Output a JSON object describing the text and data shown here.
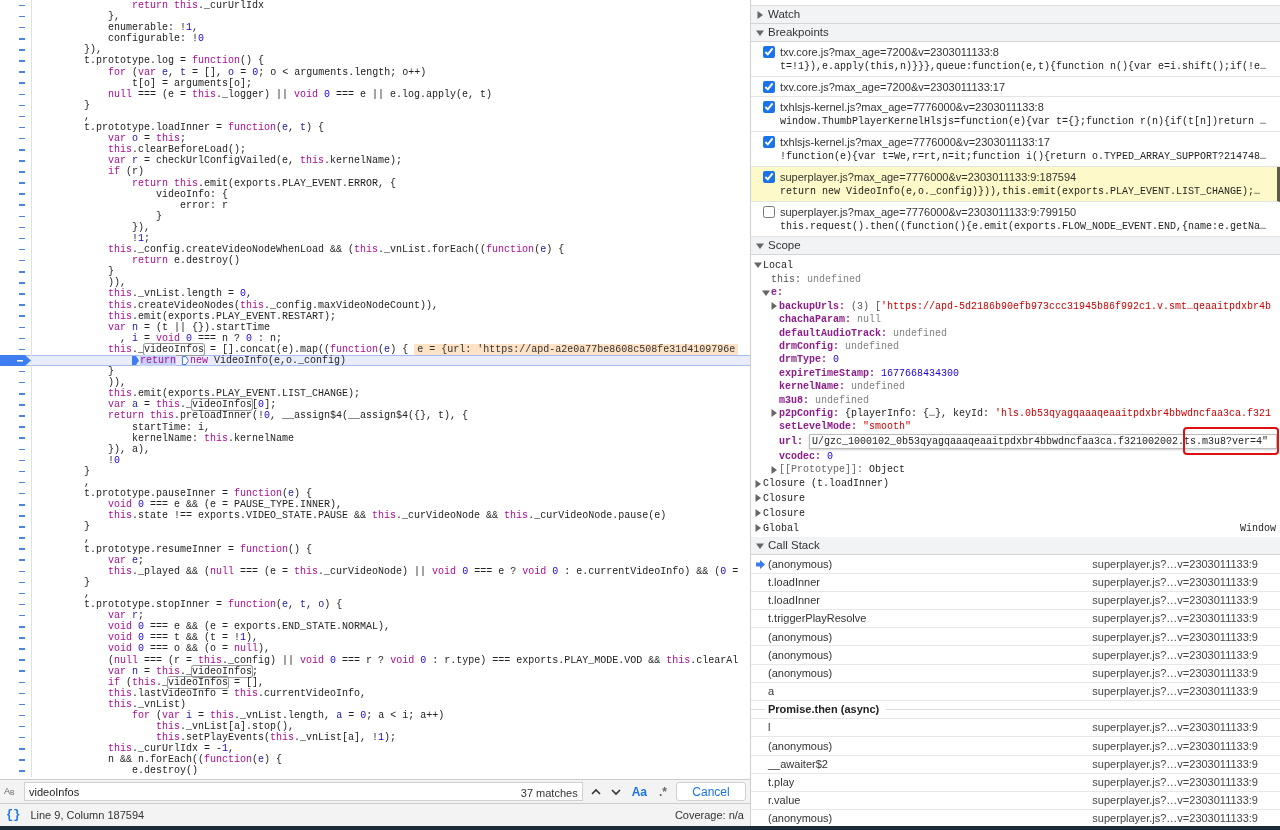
{
  "code": {
    "lines": [
      {
        "current": false,
        "tokens": [
          {
            "kind": "kw",
            "text": "                return this"
          },
          {
            "kind": "p",
            "text": "._curUrlIdx"
          }
        ]
      },
      {
        "current": false,
        "tokens": [
          {
            "kind": "p",
            "text": "            },"
          }
        ]
      },
      {
        "current": false,
        "tokens": [
          {
            "kind": "p",
            "text": "            enumerable: !"
          },
          {
            "kind": "num",
            "text": "1"
          },
          {
            "kind": "p",
            "text": ","
          }
        ]
      },
      {
        "current": false,
        "tokens": [
          {
            "kind": "p",
            "text": "            configurable: !"
          },
          {
            "kind": "num",
            "text": "0"
          }
        ]
      },
      {
        "current": false,
        "tokens": [
          {
            "kind": "p",
            "text": "        }),"
          }
        ]
      },
      {
        "current": false,
        "tokens": [
          {
            "kind": "p",
            "text": "        t.prototype.log = "
          },
          {
            "kind": "kw",
            "text": "function"
          },
          {
            "kind": "p",
            "text": "() {"
          }
        ]
      },
      {
        "current": false,
        "tokens": [
          {
            "kind": "kw",
            "text": "            for"
          },
          {
            "kind": "p",
            "text": " ("
          },
          {
            "kind": "kw",
            "text": "var "
          },
          {
            "kind": "def",
            "text": "e"
          },
          {
            "kind": "p",
            "text": ", "
          },
          {
            "kind": "def",
            "text": "t"
          },
          {
            "kind": "p",
            "text": " = [], "
          },
          {
            "kind": "def",
            "text": "o"
          },
          {
            "kind": "p",
            "text": " = "
          },
          {
            "kind": "num",
            "text": "0"
          },
          {
            "kind": "p",
            "text": "; o < arguments.length; o++)"
          }
        ]
      },
      {
        "current": false,
        "tokens": [
          {
            "kind": "p",
            "text": "                t[o] = arguments[o];"
          }
        ]
      },
      {
        "current": false,
        "tokens": [
          {
            "kind": "kw",
            "text": "            null"
          },
          {
            "kind": "p",
            "text": " === (e = "
          },
          {
            "kind": "kw",
            "text": "this"
          },
          {
            "kind": "p",
            "text": "._logger) || "
          },
          {
            "kind": "kw",
            "text": "void "
          },
          {
            "kind": "num",
            "text": "0"
          },
          {
            "kind": "p",
            "text": " === e || e.log.apply(e, t)"
          }
        ]
      },
      {
        "current": false,
        "tokens": [
          {
            "kind": "p",
            "text": "        }"
          }
        ]
      },
      {
        "current": false,
        "tokens": [
          {
            "kind": "p",
            "text": "        ,"
          }
        ]
      },
      {
        "current": false,
        "tokens": [
          {
            "kind": "p",
            "text": "        t.prototype.loadInner = "
          },
          {
            "kind": "kw",
            "text": "function"
          },
          {
            "kind": "p",
            "text": "("
          },
          {
            "kind": "def",
            "text": "e"
          },
          {
            "kind": "p",
            "text": ", "
          },
          {
            "kind": "def",
            "text": "t"
          },
          {
            "kind": "p",
            "text": ") {"
          }
        ]
      },
      {
        "current": false,
        "tokens": [
          {
            "kind": "kw",
            "text": "            var "
          },
          {
            "kind": "def",
            "text": "o"
          },
          {
            "kind": "p",
            "text": " = "
          },
          {
            "kind": "kw",
            "text": "this"
          },
          {
            "kind": "p",
            "text": ";"
          }
        ]
      },
      {
        "current": false,
        "tokens": [
          {
            "kind": "kw",
            "text": "            this"
          },
          {
            "kind": "p",
            "text": ".clearBeforeLoad();"
          }
        ]
      },
      {
        "current": false,
        "tokens": [
          {
            "kind": "kw",
            "text": "            var "
          },
          {
            "kind": "def",
            "text": "r"
          },
          {
            "kind": "p",
            "text": " = checkUrlConfigVailed(e, "
          },
          {
            "kind": "kw",
            "text": "this"
          },
          {
            "kind": "p",
            "text": ".kernelName);"
          }
        ]
      },
      {
        "current": false,
        "tokens": [
          {
            "kind": "kw",
            "text": "            if"
          },
          {
            "kind": "p",
            "text": " (r)"
          }
        ]
      },
      {
        "current": false,
        "tokens": [
          {
            "kind": "kw",
            "text": "                return this"
          },
          {
            "kind": "p",
            "text": ".emit(exports.PLAY_EVENT.ERROR, {"
          }
        ]
      },
      {
        "current": false,
        "tokens": [
          {
            "kind": "p",
            "text": "                    videoInfo: {"
          }
        ]
      },
      {
        "current": false,
        "tokens": [
          {
            "kind": "p",
            "text": "                        error: r"
          }
        ]
      },
      {
        "current": false,
        "tokens": [
          {
            "kind": "p",
            "text": "                    }"
          }
        ]
      },
      {
        "current": false,
        "tokens": [
          {
            "kind": "p",
            "text": "                }),"
          }
        ]
      },
      {
        "current": false,
        "tokens": [
          {
            "kind": "p",
            "text": "                !"
          },
          {
            "kind": "num",
            "text": "1"
          },
          {
            "kind": "p",
            "text": ";"
          }
        ]
      },
      {
        "current": false,
        "tokens": [
          {
            "kind": "kw",
            "text": "            this"
          },
          {
            "kind": "p",
            "text": "._config.createVideoNodeWhenLoad && ("
          },
          {
            "kind": "kw",
            "text": "this"
          },
          {
            "kind": "p",
            "text": "._vnList.forEach(("
          },
          {
            "kind": "kw",
            "text": "function"
          },
          {
            "kind": "p",
            "text": "("
          },
          {
            "kind": "def",
            "text": "e"
          },
          {
            "kind": "p",
            "text": ") {"
          }
        ]
      },
      {
        "current": false,
        "tokens": [
          {
            "kind": "kw",
            "text": "                return"
          },
          {
            "kind": "p",
            "text": " e.destroy()"
          }
        ]
      },
      {
        "current": false,
        "tokens": [
          {
            "kind": "p",
            "text": "            }"
          }
        ]
      },
      {
        "current": false,
        "tokens": [
          {
            "kind": "p",
            "text": "            )),"
          }
        ]
      },
      {
        "current": false,
        "tokens": [
          {
            "kind": "kw",
            "text": "            this"
          },
          {
            "kind": "p",
            "text": "._vnList.length = "
          },
          {
            "kind": "num",
            "text": "0"
          },
          {
            "kind": "p",
            "text": ","
          }
        ]
      },
      {
        "current": false,
        "tokens": [
          {
            "kind": "kw",
            "text": "            this"
          },
          {
            "kind": "p",
            "text": ".createVideoNodes("
          },
          {
            "kind": "kw",
            "text": "this"
          },
          {
            "kind": "p",
            "text": "._config.maxVideoNodeCount)),"
          }
        ]
      },
      {
        "current": false,
        "tokens": [
          {
            "kind": "kw",
            "text": "            this"
          },
          {
            "kind": "p",
            "text": ".emit(exports.PLAY_EVENT.RESTART);"
          }
        ]
      },
      {
        "current": false,
        "tokens": [
          {
            "kind": "kw",
            "text": "            var "
          },
          {
            "kind": "def",
            "text": "n"
          },
          {
            "kind": "p",
            "text": " = (t || {}).startTime"
          }
        ]
      },
      {
        "current": false,
        "tokens": [
          {
            "kind": "p",
            "text": "              , "
          },
          {
            "kind": "def",
            "text": "i"
          },
          {
            "kind": "p",
            "text": " = "
          },
          {
            "kind": "kw",
            "text": "void "
          },
          {
            "kind": "num",
            "text": "0"
          },
          {
            "kind": "p",
            "text": " === n ? "
          },
          {
            "kind": "num",
            "text": "0"
          },
          {
            "kind": "p",
            "text": " : n;"
          }
        ]
      },
      {
        "current": false,
        "tokens": [
          {
            "kind": "kw",
            "text": "            this"
          },
          {
            "kind": "p",
            "text": "._"
          },
          {
            "kind": "match",
            "text": "videoInfos"
          },
          {
            "kind": "p",
            "text": " = [].concat(e).map(("
          },
          {
            "kind": "kw",
            "text": "function"
          },
          {
            "kind": "p",
            "text": "("
          },
          {
            "kind": "def",
            "text": "e"
          },
          {
            "kind": "p",
            "text": ") {"
          },
          {
            "kind": "inline",
            "text": "e = {url: 'https://apd-a2e0a77be8608c508fe31d4109796e"
          }
        ]
      },
      {
        "current": true,
        "tokens": [
          {
            "kind": "bp",
            "text": "                return"
          },
          {
            "kind": "bpoff",
            "text": " new"
          },
          {
            "kind": "p",
            "text": " VideoInfo(e,o._config)"
          }
        ]
      },
      {
        "current": false,
        "tokens": [
          {
            "kind": "p",
            "text": "            }"
          }
        ]
      },
      {
        "current": false,
        "tokens": [
          {
            "kind": "p",
            "text": "            )),"
          }
        ]
      },
      {
        "current": false,
        "tokens": [
          {
            "kind": "kw",
            "text": "            this"
          },
          {
            "kind": "p",
            "text": ".emit(exports.PLAY_EVENT.LIST_CHANGE);"
          }
        ]
      },
      {
        "current": false,
        "tokens": [
          {
            "kind": "kw",
            "text": "            var "
          },
          {
            "kind": "def",
            "text": "a"
          },
          {
            "kind": "p",
            "text": " = "
          },
          {
            "kind": "kw",
            "text": "this"
          },
          {
            "kind": "p",
            "text": "._"
          },
          {
            "kind": "match",
            "text": "videoInfos"
          },
          {
            "kind": "p",
            "text": "["
          },
          {
            "kind": "num",
            "text": "0"
          },
          {
            "kind": "p",
            "text": "];"
          }
        ]
      },
      {
        "current": false,
        "tokens": [
          {
            "kind": "kw",
            "text": "            return this"
          },
          {
            "kind": "p",
            "text": ".preloadInner(!"
          },
          {
            "kind": "num",
            "text": "0"
          },
          {
            "kind": "p",
            "text": ", __assign$4(__assign$4({}, t), {"
          }
        ]
      },
      {
        "current": false,
        "tokens": [
          {
            "kind": "p",
            "text": "                startTime: i,"
          }
        ]
      },
      {
        "current": false,
        "tokens": [
          {
            "kind": "p",
            "text": "                kernelName: "
          },
          {
            "kind": "kw",
            "text": "this"
          },
          {
            "kind": "p",
            "text": ".kernelName"
          }
        ]
      },
      {
        "current": false,
        "tokens": [
          {
            "kind": "p",
            "text": "            }), a),"
          }
        ]
      },
      {
        "current": false,
        "tokens": [
          {
            "kind": "p",
            "text": "            !"
          },
          {
            "kind": "num",
            "text": "0"
          }
        ]
      },
      {
        "current": false,
        "tokens": [
          {
            "kind": "p",
            "text": "        }"
          }
        ]
      },
      {
        "current": false,
        "tokens": [
          {
            "kind": "p",
            "text": "        ,"
          }
        ]
      },
      {
        "current": false,
        "tokens": [
          {
            "kind": "p",
            "text": "        t.prototype.pauseInner = "
          },
          {
            "kind": "kw",
            "text": "function"
          },
          {
            "kind": "p",
            "text": "("
          },
          {
            "kind": "def",
            "text": "e"
          },
          {
            "kind": "p",
            "text": ") {"
          }
        ]
      },
      {
        "current": false,
        "tokens": [
          {
            "kind": "kw",
            "text": "            void "
          },
          {
            "kind": "num",
            "text": "0"
          },
          {
            "kind": "p",
            "text": " === e && (e = PAUSE_TYPE.INNER),"
          }
        ]
      },
      {
        "current": false,
        "tokens": [
          {
            "kind": "kw",
            "text": "            this"
          },
          {
            "kind": "p",
            "text": ".state !== exports.VIDEO_STATE.PAUSE && "
          },
          {
            "kind": "kw",
            "text": "this"
          },
          {
            "kind": "p",
            "text": "._curVideoNode && "
          },
          {
            "kind": "kw",
            "text": "this"
          },
          {
            "kind": "p",
            "text": "._curVideoNode.pause(e)"
          }
        ]
      },
      {
        "current": false,
        "tokens": [
          {
            "kind": "p",
            "text": "        }"
          }
        ]
      },
      {
        "current": false,
        "tokens": [
          {
            "kind": "p",
            "text": "        ,"
          }
        ]
      },
      {
        "current": false,
        "tokens": [
          {
            "kind": "p",
            "text": "        t.prototype.resumeInner = "
          },
          {
            "kind": "kw",
            "text": "function"
          },
          {
            "kind": "p",
            "text": "() {"
          }
        ]
      },
      {
        "current": false,
        "tokens": [
          {
            "kind": "kw",
            "text": "            var "
          },
          {
            "kind": "def",
            "text": "e"
          },
          {
            "kind": "p",
            "text": ";"
          }
        ]
      },
      {
        "current": false,
        "tokens": [
          {
            "kind": "kw",
            "text": "            this"
          },
          {
            "kind": "p",
            "text": "._played && ("
          },
          {
            "kind": "kw",
            "text": "null"
          },
          {
            "kind": "p",
            "text": " === (e = "
          },
          {
            "kind": "kw",
            "text": "this"
          },
          {
            "kind": "p",
            "text": "._curVideoNode) || "
          },
          {
            "kind": "kw",
            "text": "void "
          },
          {
            "kind": "num",
            "text": "0"
          },
          {
            "kind": "p",
            "text": " === e ? "
          },
          {
            "kind": "kw",
            "text": "void "
          },
          {
            "kind": "num",
            "text": "0"
          },
          {
            "kind": "p",
            "text": " : e.currentVideoInfo) && ("
          },
          {
            "kind": "num",
            "text": "0"
          },
          {
            "kind": "p",
            "text": " ="
          }
        ]
      },
      {
        "current": false,
        "tokens": [
          {
            "kind": "p",
            "text": "        }"
          }
        ]
      },
      {
        "current": false,
        "tokens": [
          {
            "kind": "p",
            "text": "        ,"
          }
        ]
      },
      {
        "current": false,
        "tokens": [
          {
            "kind": "p",
            "text": "        t.prototype.stopInner = "
          },
          {
            "kind": "kw",
            "text": "function"
          },
          {
            "kind": "p",
            "text": "("
          },
          {
            "kind": "def",
            "text": "e"
          },
          {
            "kind": "p",
            "text": ", "
          },
          {
            "kind": "def",
            "text": "t"
          },
          {
            "kind": "p",
            "text": ", "
          },
          {
            "kind": "def",
            "text": "o"
          },
          {
            "kind": "p",
            "text": ") {"
          }
        ]
      },
      {
        "current": false,
        "tokens": [
          {
            "kind": "kw",
            "text": "            var "
          },
          {
            "kind": "def",
            "text": "r"
          },
          {
            "kind": "p",
            "text": ";"
          }
        ]
      },
      {
        "current": false,
        "tokens": [
          {
            "kind": "kw",
            "text": "            void "
          },
          {
            "kind": "num",
            "text": "0"
          },
          {
            "kind": "p",
            "text": " === e && (e = exports.END_STATE.NORMAL),"
          }
        ]
      },
      {
        "current": false,
        "tokens": [
          {
            "kind": "kw",
            "text": "            void "
          },
          {
            "kind": "num",
            "text": "0"
          },
          {
            "kind": "p",
            "text": " === t && (t = !"
          },
          {
            "kind": "num",
            "text": "1"
          },
          {
            "kind": "p",
            "text": "),"
          }
        ]
      },
      {
        "current": false,
        "tokens": [
          {
            "kind": "kw",
            "text": "            void "
          },
          {
            "kind": "num",
            "text": "0"
          },
          {
            "kind": "p",
            "text": " === o && (o = "
          },
          {
            "kind": "kw",
            "text": "null"
          },
          {
            "kind": "p",
            "text": "),"
          }
        ]
      },
      {
        "current": false,
        "tokens": [
          {
            "kind": "p",
            "text": "            ("
          },
          {
            "kind": "kw",
            "text": "null"
          },
          {
            "kind": "p",
            "text": " === (r = "
          },
          {
            "kind": "kw",
            "text": "this"
          },
          {
            "kind": "p",
            "text": "._config) || "
          },
          {
            "kind": "kw",
            "text": "void "
          },
          {
            "kind": "num",
            "text": "0"
          },
          {
            "kind": "p",
            "text": " === r ? "
          },
          {
            "kind": "kw",
            "text": "void "
          },
          {
            "kind": "num",
            "text": "0"
          },
          {
            "kind": "p",
            "text": " : r.type) === exports.PLAY_MODE.VOD && "
          },
          {
            "kind": "kw",
            "text": "this"
          },
          {
            "kind": "p",
            "text": ".clearAl"
          }
        ]
      },
      {
        "current": false,
        "tokens": [
          {
            "kind": "kw",
            "text": "            var "
          },
          {
            "kind": "def",
            "text": "n"
          },
          {
            "kind": "p",
            "text": " = "
          },
          {
            "kind": "kw",
            "text": "this"
          },
          {
            "kind": "p",
            "text": "._"
          },
          {
            "kind": "match",
            "text": "videoInfos"
          },
          {
            "kind": "p",
            "text": ";"
          }
        ]
      },
      {
        "current": false,
        "tokens": [
          {
            "kind": "kw",
            "text": "            if"
          },
          {
            "kind": "p",
            "text": " ("
          },
          {
            "kind": "kw",
            "text": "this"
          },
          {
            "kind": "p",
            "text": "._"
          },
          {
            "kind": "match",
            "text": "videoInfos"
          },
          {
            "kind": "p",
            "text": " = [],"
          }
        ]
      },
      {
        "current": false,
        "tokens": [
          {
            "kind": "kw",
            "text": "            this"
          },
          {
            "kind": "p",
            "text": ".lastVideoInfo = "
          },
          {
            "kind": "kw",
            "text": "this"
          },
          {
            "kind": "p",
            "text": ".currentVideoInfo,"
          }
        ]
      },
      {
        "current": false,
        "tokens": [
          {
            "kind": "kw",
            "text": "            this"
          },
          {
            "kind": "p",
            "text": "._vnList)"
          }
        ]
      },
      {
        "current": false,
        "tokens": [
          {
            "kind": "kw",
            "text": "                for"
          },
          {
            "kind": "p",
            "text": " ("
          },
          {
            "kind": "kw",
            "text": "var "
          },
          {
            "kind": "def",
            "text": "i"
          },
          {
            "kind": "p",
            "text": " = "
          },
          {
            "kind": "kw",
            "text": "this"
          },
          {
            "kind": "p",
            "text": "._vnList.length, "
          },
          {
            "kind": "def",
            "text": "a"
          },
          {
            "kind": "p",
            "text": " = "
          },
          {
            "kind": "num",
            "text": "0"
          },
          {
            "kind": "p",
            "text": "; a < i; a++)"
          }
        ]
      },
      {
        "current": false,
        "tokens": [
          {
            "kind": "kw",
            "text": "                    this"
          },
          {
            "kind": "p",
            "text": "._vnList[a].stop(),"
          }
        ]
      },
      {
        "current": false,
        "tokens": [
          {
            "kind": "kw",
            "text": "                    this"
          },
          {
            "kind": "p",
            "text": ".setPlayEvents("
          },
          {
            "kind": "kw",
            "text": "this"
          },
          {
            "kind": "p",
            "text": "._vnList[a], !"
          },
          {
            "kind": "num",
            "text": "1"
          },
          {
            "kind": "p",
            "text": ");"
          }
        ]
      },
      {
        "current": false,
        "tokens": [
          {
            "kind": "kw",
            "text": "            this"
          },
          {
            "kind": "p",
            "text": "._curUrlIdx = -"
          },
          {
            "kind": "num",
            "text": "1"
          },
          {
            "kind": "p",
            "text": ","
          }
        ]
      },
      {
        "current": false,
        "tokens": [
          {
            "kind": "p",
            "text": "            n && n.forEach(("
          },
          {
            "kind": "kw",
            "text": "function"
          },
          {
            "kind": "p",
            "text": "("
          },
          {
            "kind": "def",
            "text": "e"
          },
          {
            "kind": "p",
            "text": ") {"
          }
        ]
      },
      {
        "current": false,
        "tokens": [
          {
            "kind": "p",
            "text": "                e.destroy()"
          }
        ]
      }
    ]
  },
  "search": {
    "replace_label": "A$_{B}$",
    "query": "videoInfos",
    "matches": "37 matches",
    "match_case": {
      "label": "Aa",
      "on": true
    },
    "regex": {
      "label": ".*",
      "on": false
    },
    "cancel": "Cancel"
  },
  "status_bar": {
    "format_icon": "{}",
    "position": "Line 9, Column 187594",
    "coverage": "Coverage: n/a"
  },
  "watch": {
    "title": "Watch",
    "expanded": false
  },
  "breakpoints": {
    "title": "Breakpoints",
    "expanded": true,
    "items": [
      {
        "location": "txv.core.js?max_age=7200&v=2303011133:8",
        "snippet": "t=!1}),e.apply(this,n)}}},queue:function(e,t){function n(){var e=i.shift();if(!e…",
        "checked": true,
        "paused": false
      },
      {
        "location": "txv.core.js?max_age=7200&v=2303011133:17",
        "checked": true,
        "paused": false
      },
      {
        "location": "txhlsjs-kernel.js?max_age=7776000&v=2303011133:8",
        "snippet": "window.ThumbPlayerKernelHlsjs=function(e){var t={};function r(n){if(t[n])return …",
        "checked": true,
        "paused": false
      },
      {
        "location": "txhlsjs-kernel.js?max_age=7776000&v=2303011133:17",
        "snippet": "!function(e){var t=We,r=rt,n=it;function i(){return o.TYPED_ARRAY_SUPPORT?214748…",
        "checked": true,
        "paused": false
      },
      {
        "location": "superplayer.js?max_age=7776000&v=2303011133:9:187594",
        "snippet": "return new VideoInfo(e,o._config)})),this.emit(exports.PLAY_EVENT.LIST_CHANGE);…",
        "checked": true,
        "paused": true
      },
      {
        "location": "superplayer.js?max_age=7776000&v=2303011133:9:799150",
        "snippet": "this.request().then((function(){e.emit(exports.FLOW_NODE_EVENT.END,{name:e.getNa…",
        "checked": false,
        "paused": false
      }
    ]
  },
  "scope": {
    "title": "Scope",
    "expanded": true,
    "items": [
      {
        "label": "Local",
        "expanded": true,
        "children": [
          {
            "key": "this:",
            "kind": "dim",
            "value": [
              {
                "kind": "undef",
                "text": "undefined"
              }
            ]
          },
          {
            "key": "e:",
            "expanded": true,
            "children": [
              {
                "key": "backupUrls:",
                "expanded": false,
                "value": [
                  {
                    "kind": "dim",
                    "text": "(3) ["
                  },
                  {
                    "kind": "str",
                    "text": "'https://apd-5d2186b90efb973ccc31945b86f992c1.v.smt…qeaaitpdxbr4b"
                  }
                ]
              },
              {
                "key": "chachaParam:",
                "value": [
                  {
                    "kind": "undef",
                    "text": "null"
                  }
                ]
              },
              {
                "key": "defaultAudioTrack:",
                "value": [
                  {
                    "kind": "undef",
                    "text": "undefined"
                  }
                ]
              },
              {
                "key": "drmConfig:",
                "value": [
                  {
                    "kind": "undef",
                    "text": "undefined"
                  }
                ]
              },
              {
                "key": "drmType:",
                "value": [
                  {
                    "kind": "num",
                    "text": "0"
                  }
                ]
              },
              {
                "key": "expireTimeStamp:",
                "value": [
                  {
                    "kind": "num",
                    "text": "1677668434300"
                  }
                ]
              },
              {
                "key": "kernelName:",
                "value": [
                  {
                    "kind": "undef",
                    "text": "undefined"
                  }
                ]
              },
              {
                "key": "m3u8:",
                "value": [
                  {
                    "kind": "undef",
                    "text": "undefined"
                  }
                ]
              },
              {
                "key": "p2pConfig:",
                "expanded": false,
                "value": [
                  {
                    "kind": "p",
                    "text": "{playerInfo: {…}, keyId: "
                  },
                  {
                    "kind": "str",
                    "text": "'hls.0b53qyagqaaaqeaaitpdxbr4bbwdncfaa3ca.f321"
                  }
                ]
              },
              {
                "key": "setLevelMode:",
                "value": [
                  {
                    "kind": "str",
                    "text": "\"smooth\""
                  }
                ]
              },
              {
                "key": "url:",
                "editor": "U/gzc_1000102_0b53qyagqaaaqeaaitpdxbr4bbwdncfaa3ca.f321002002.ts.m3u8?ver=4\"",
                "annotated": true
              },
              {
                "key": "vcodec:",
                "value": [
                  {
                    "kind": "num",
                    "text": "0"
                  }
                ]
              },
              {
                "key": "[[Prototype]]:",
                "kind": "internal",
                "expanded": false,
                "value": [
                  {
                    "kind": "p",
                    "text": "Object"
                  }
                ]
              }
            ]
          }
        ]
      },
      {
        "label": "Closure (t.loadInner)",
        "expanded": false
      },
      {
        "label": "Closure",
        "expanded": false
      },
      {
        "label": "Closure",
        "expanded": false
      },
      {
        "label": "Global",
        "expanded": false,
        "value": "Window"
      }
    ]
  },
  "call_stack": {
    "title": "Call Stack",
    "expanded": true,
    "items": [
      {
        "kind": "frame",
        "name": "(anonymous)",
        "location": "superplayer.js?…v=2303011133:9",
        "selected": true
      },
      {
        "kind": "frame",
        "name": "t.loadInner",
        "location": "superplayer.js?…v=2303011133:9",
        "selected": false
      },
      {
        "kind": "frame",
        "name": "t.loadInner",
        "location": "superplayer.js?…v=2303011133:9",
        "selected": false
      },
      {
        "kind": "frame",
        "name": "t.triggerPlayResolve",
        "location": "superplayer.js?…v=2303011133:9",
        "selected": false
      },
      {
        "kind": "frame",
        "name": "(anonymous)",
        "location": "superplayer.js?…v=2303011133:9",
        "selected": false
      },
      {
        "kind": "frame",
        "name": "(anonymous)",
        "location": "superplayer.js?…v=2303011133:9",
        "selected": false
      },
      {
        "kind": "frame",
        "name": "(anonymous)",
        "location": "superplayer.js?…v=2303011133:9",
        "selected": false
      },
      {
        "kind": "frame",
        "name": "a",
        "location": "superplayer.js?…v=2303011133:9",
        "selected": false
      },
      {
        "kind": "async",
        "name": "Promise.then (async)"
      },
      {
        "kind": "frame",
        "name": "l",
        "location": "superplayer.js?…v=2303011133:9",
        "selected": false
      },
      {
        "kind": "frame",
        "name": "(anonymous)",
        "location": "superplayer.js?…v=2303011133:9",
        "selected": false
      },
      {
        "kind": "frame",
        "name": "__awaiter$2",
        "location": "superplayer.js?…v=2303011133:9",
        "selected": false
      },
      {
        "kind": "frame",
        "name": "t.play",
        "location": "superplayer.js?…v=2303011133:9",
        "selected": false
      },
      {
        "kind": "frame",
        "name": "r.value",
        "location": "superplayer.js?…v=2303011133:9",
        "selected": false
      },
      {
        "kind": "frame",
        "name": "(anonymous)",
        "location": "superplayer.js?…v=2303011133:9",
        "selected": false
      }
    ]
  }
}
